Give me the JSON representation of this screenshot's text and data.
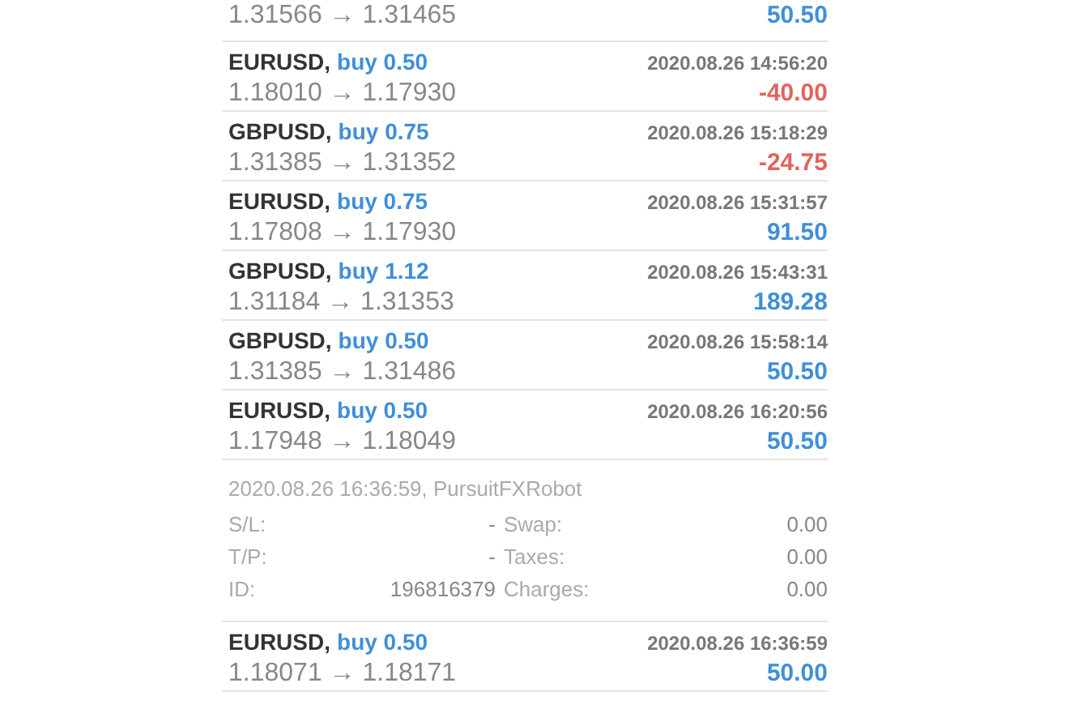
{
  "trades": [
    {
      "prices": "1.31566 → 1.31465",
      "profit": "50.50",
      "kind": "profit"
    },
    {
      "symbol": "EURUSD,",
      "side": "buy 0.50",
      "time": "2020.08.26 14:56:20",
      "prices": "1.18010 → 1.17930",
      "profit": "-40.00",
      "kind": "loss"
    },
    {
      "symbol": "GBPUSD,",
      "side": "buy 0.75",
      "time": "2020.08.26 15:18:29",
      "prices": "1.31385 → 1.31352",
      "profit": "-24.75",
      "kind": "loss"
    },
    {
      "symbol": "EURUSD,",
      "side": "buy 0.75",
      "time": "2020.08.26 15:31:57",
      "prices": "1.17808 → 1.17930",
      "profit": "91.50",
      "kind": "profit"
    },
    {
      "symbol": "GBPUSD,",
      "side": "buy 1.12",
      "time": "2020.08.26 15:43:31",
      "prices": "1.31184 → 1.31353",
      "profit": "189.28",
      "kind": "profit"
    },
    {
      "symbol": "GBPUSD,",
      "side": "buy 0.50",
      "time": "2020.08.26 15:58:14",
      "prices": "1.31385 → 1.31486",
      "profit": "50.50",
      "kind": "profit"
    },
    {
      "symbol": "EURUSD,",
      "side": "buy 0.50",
      "time": "2020.08.26 16:20:56",
      "prices": "1.17948 → 1.18049",
      "profit": "50.50",
      "kind": "profit",
      "details": {
        "opened": "2020.08.26 16:36:59, PursuitFXRobot",
        "fields": [
          {
            "label": "S/L:",
            "value": "-",
            "label2": "Swap:",
            "value2": "0.00"
          },
          {
            "label": "T/P:",
            "value": "-",
            "label2": "Taxes:",
            "value2": "0.00"
          },
          {
            "label": "ID:",
            "value": "196816379",
            "label2": "Charges:",
            "value2": "0.00"
          }
        ]
      }
    },
    {
      "symbol": "EURUSD,",
      "side": "buy 0.50",
      "time": "2020.08.26 16:36:59",
      "prices": "1.18071 → 1.18171",
      "profit": "50.00",
      "kind": "profit"
    }
  ]
}
